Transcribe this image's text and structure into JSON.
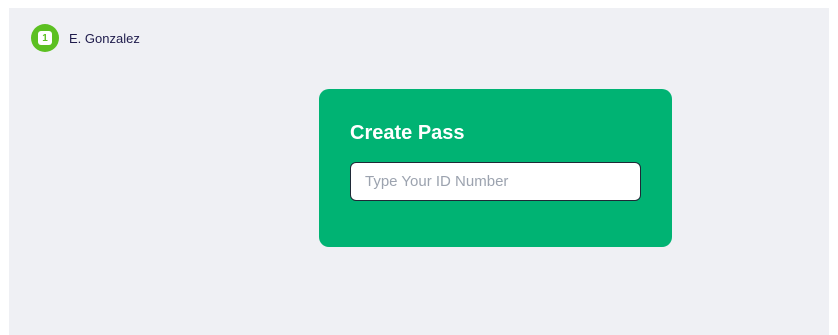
{
  "user": {
    "badge_number": "1",
    "name": "E. Gonzalez"
  },
  "card": {
    "title": "Create Pass",
    "id_input": {
      "value": "",
      "placeholder": "Type Your ID Number"
    }
  },
  "colors": {
    "background": "#eff0f4",
    "card": "#00b373",
    "badge": "#5cc021",
    "name_text": "#1e1b4b"
  }
}
